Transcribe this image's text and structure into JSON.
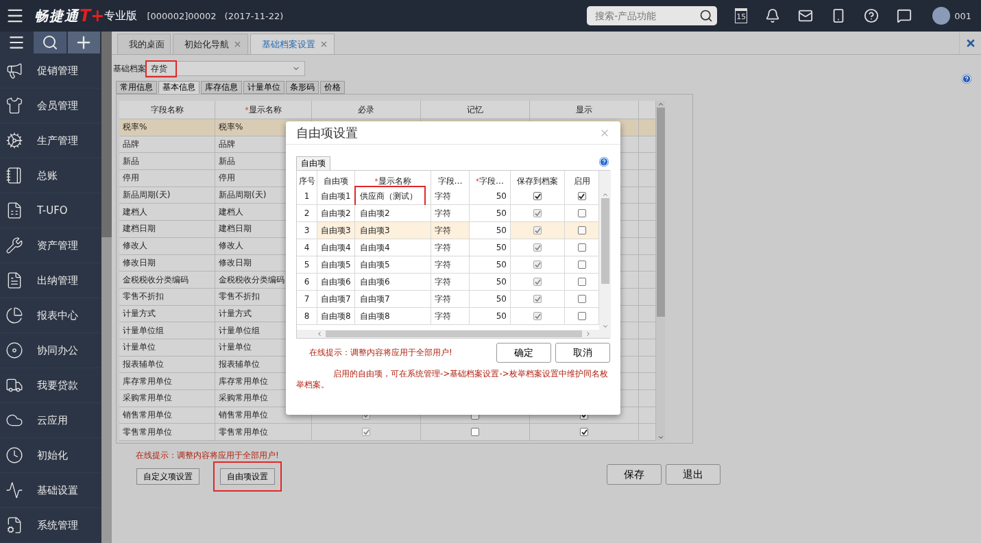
{
  "top_bar": {
    "brand": "畅捷通",
    "brand_badge": "T+",
    "edition": "专业版",
    "account": "[000002]00002",
    "date": "(2017-11-22)",
    "search": {
      "placeholder": "搜索-产品功能"
    },
    "calendar_day": "15",
    "user": "001"
  },
  "sidebar": {
    "items": [
      {
        "label": "促销管理"
      },
      {
        "label": "会员管理"
      },
      {
        "label": "生产管理"
      },
      {
        "label": "总账"
      },
      {
        "label": "T-UFO"
      },
      {
        "label": "资产管理"
      },
      {
        "label": "出纳管理"
      },
      {
        "label": "报表中心"
      },
      {
        "label": "协同办公"
      },
      {
        "label": "我要贷款"
      },
      {
        "label": "云应用"
      },
      {
        "label": "初始化"
      },
      {
        "label": "基础设置"
      },
      {
        "label": "系统管理"
      }
    ]
  },
  "tabs": [
    {
      "label": "我的桌面",
      "closable": false,
      "selected": false
    },
    {
      "label": "初始化导航",
      "closable": true,
      "selected": false
    },
    {
      "label": "基础档案设置",
      "closable": true,
      "selected": true
    }
  ],
  "archive": {
    "label": "基础档案",
    "value": "存货",
    "highlighted": true
  },
  "sub_tabs": [
    {
      "label": "常用信息",
      "selected": false
    },
    {
      "label": "基本信息",
      "selected": true
    },
    {
      "label": "库存信息",
      "selected": false
    },
    {
      "label": "计量单位",
      "selected": false
    },
    {
      "label": "条形码",
      "selected": false
    },
    {
      "label": "价格",
      "selected": false
    }
  ],
  "table": {
    "columns": [
      {
        "label": "字段名称"
      },
      {
        "marker": "*",
        "label": "显示名称"
      },
      {
        "label": "必录"
      },
      {
        "label": "记忆"
      },
      {
        "label": "显示"
      }
    ],
    "rows": [
      {
        "field": "税率%",
        "display": "税率%",
        "selected": true
      },
      {
        "field": "品牌",
        "display": "品牌",
        "selected": false
      },
      {
        "field": "新品",
        "display": "新品",
        "selected": false
      },
      {
        "field": "停用",
        "display": "停用",
        "selected": false
      },
      {
        "field": "新品周期(天)",
        "display": "新品周期(天)",
        "selected": false
      },
      {
        "field": "建档人",
        "display": "建档人",
        "selected": false
      },
      {
        "field": "建档日期",
        "display": "建档日期",
        "selected": false
      },
      {
        "field": "修改人",
        "display": "修改人",
        "selected": false
      },
      {
        "field": "修改日期",
        "display": "修改日期",
        "selected": false
      },
      {
        "field": "金税税收分类编码",
        "display": "金税税收分类编码",
        "selected": false
      },
      {
        "field": "零售不折扣",
        "display": "零售不折扣",
        "selected": false
      },
      {
        "field": "计量方式",
        "display": "计量方式",
        "selected": false
      },
      {
        "field": "计量单位组",
        "display": "计量单位组",
        "selected": false
      },
      {
        "field": "计量单位",
        "display": "计量单位",
        "selected": false
      },
      {
        "field": "报表辅单位",
        "display": "报表辅单位",
        "selected": false
      },
      {
        "field": "库存常用单位",
        "display": "库存常用单位",
        "selected": false
      },
      {
        "field": "采购常用单位",
        "display": "采购常用单位",
        "selected": false
      },
      {
        "field": "销售常用单位",
        "display": "销售常用单位",
        "selected": false,
        "checks": [
          {
            "checked": true,
            "disabled": true
          },
          {
            "checked": false,
            "disabled": false
          },
          {
            "checked": true,
            "disabled": false
          }
        ]
      },
      {
        "field": "零售常用单位",
        "display": "零售常用单位",
        "selected": false,
        "checks": [
          {
            "checked": true,
            "disabled": true
          },
          {
            "checked": false,
            "disabled": false
          },
          {
            "checked": true,
            "disabled": false
          }
        ]
      }
    ]
  },
  "hint": "在线提示：调整内容将应用于全部用户!",
  "buttons_left": [
    {
      "label": "自定义项设置",
      "highlighted": false
    },
    {
      "label": "自由项设置",
      "highlighted": true
    }
  ],
  "buttons_right": [
    "保存",
    "退出"
  ],
  "dialog": {
    "title": "自由项设置",
    "tab": "自由项",
    "columns": [
      {
        "label": "序号"
      },
      {
        "label": "自由项"
      },
      {
        "marker": "*",
        "label": "显示名称"
      },
      {
        "label": "字段…"
      },
      {
        "marker": "*",
        "label": "字段…"
      },
      {
        "label": "保存到档案"
      },
      {
        "label": "启用"
      }
    ],
    "rows": [
      {
        "no": "1",
        "item": "自由项1",
        "name": "供应商（测试）",
        "name_highlighted": true,
        "type": "字符",
        "length": "50",
        "save": {
          "checked": true,
          "disabled": false
        },
        "enabled": true,
        "selected": false
      },
      {
        "no": "2",
        "item": "自由项2",
        "name": "自由项2",
        "name_highlighted": false,
        "type": "字符",
        "length": "50",
        "save": {
          "checked": true,
          "disabled": true
        },
        "enabled": false,
        "selected": false
      },
      {
        "no": "3",
        "item": "自由项3",
        "name": "自由项3",
        "name_highlighted": false,
        "type": "字符",
        "length": "50",
        "save": {
          "checked": true,
          "disabled": true
        },
        "enabled": false,
        "selected": true
      },
      {
        "no": "4",
        "item": "自由项4",
        "name": "自由项4",
        "name_highlighted": false,
        "type": "字符",
        "length": "50",
        "save": {
          "checked": true,
          "disabled": true
        },
        "enabled": false,
        "selected": false
      },
      {
        "no": "5",
        "item": "自由项5",
        "name": "自由项5",
        "name_highlighted": false,
        "type": "字符",
        "length": "50",
        "save": {
          "checked": true,
          "disabled": true
        },
        "enabled": false,
        "selected": false
      },
      {
        "no": "6",
        "item": "自由项6",
        "name": "自由项6",
        "name_highlighted": false,
        "type": "字符",
        "length": "50",
        "save": {
          "checked": true,
          "disabled": true
        },
        "enabled": false,
        "selected": false
      },
      {
        "no": "7",
        "item": "自由项7",
        "name": "自由项7",
        "name_highlighted": false,
        "type": "字符",
        "length": "50",
        "save": {
          "checked": true,
          "disabled": true
        },
        "enabled": false,
        "selected": false
      },
      {
        "no": "8",
        "item": "自由项8",
        "name": "自由项8",
        "name_highlighted": false,
        "type": "字符",
        "length": "50",
        "save": {
          "checked": true,
          "disabled": true
        },
        "enabled": false,
        "selected": false
      }
    ],
    "hint": "在线提示：调整内容将应用于全部用户!",
    "note": "启用的自由项，可在系统管理->基础档案设置->枚举档案设置中维护同名枚举档案。",
    "buttons": [
      "确定",
      "取消"
    ]
  }
}
